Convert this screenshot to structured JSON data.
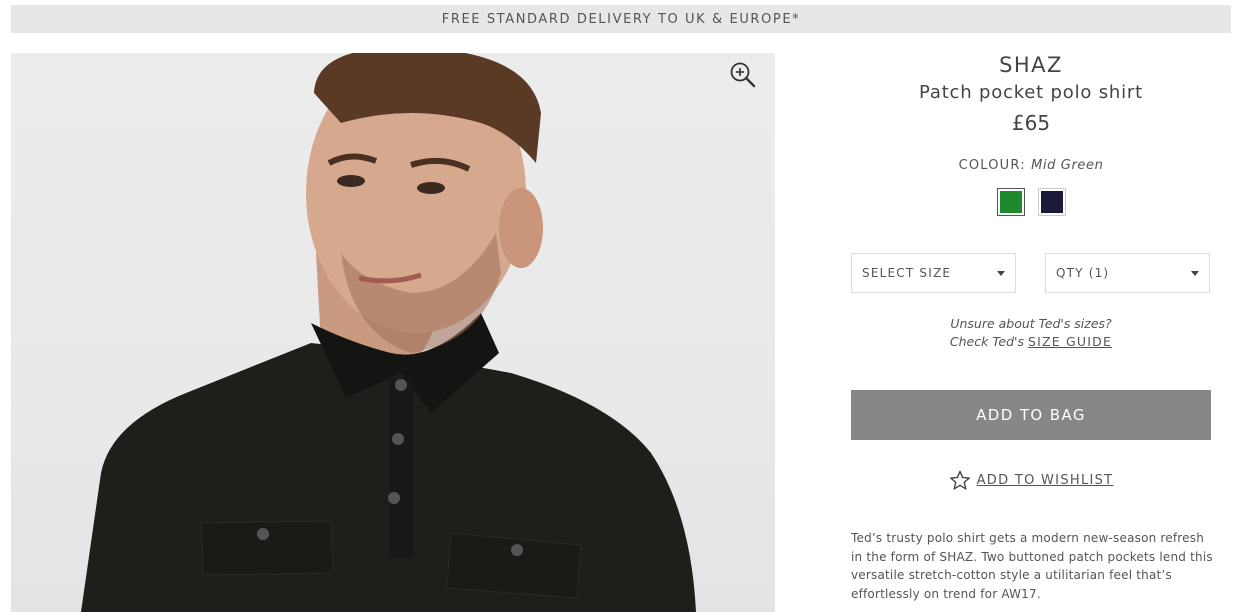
{
  "promo": {
    "text": "FREE STANDARD DELIVERY TO UK & EUROPE*"
  },
  "image": {
    "zoom_icon": "zoom-in-icon"
  },
  "product": {
    "brand": "SHAZ",
    "name": "Patch pocket polo shirt",
    "price": "£65",
    "colour_label": "COLOUR:",
    "colour_value": "Mid Green",
    "swatches": [
      {
        "name": "Mid Green",
        "color": "#1e8a2e",
        "selected": true
      },
      {
        "name": "Navy",
        "color": "#1c1a3a",
        "selected": false
      }
    ]
  },
  "selects": {
    "size": {
      "label": "SELECT SIZE"
    },
    "qty": {
      "label": "QTY (1)"
    }
  },
  "size_help": {
    "line1": "Unsure about Ted's sizes?",
    "line2_prefix": "Check Ted's",
    "link": "SIZE GUIDE"
  },
  "actions": {
    "add_to_bag": "ADD TO BAG",
    "wishlist": "ADD TO WISHLIST",
    "wishlist_icon": "star-icon"
  },
  "description": "Ted’s trusty polo shirt gets a modern new-season refresh in the form of SHAZ. Two buttoned patch pockets lend this versatile stretch-cotton style a utilitarian feel that’s effortlessly on trend for AW17.",
  "colors": {
    "promo_bg": "#e6e7e6",
    "button_bg": "#87878a",
    "text": "#555555"
  }
}
